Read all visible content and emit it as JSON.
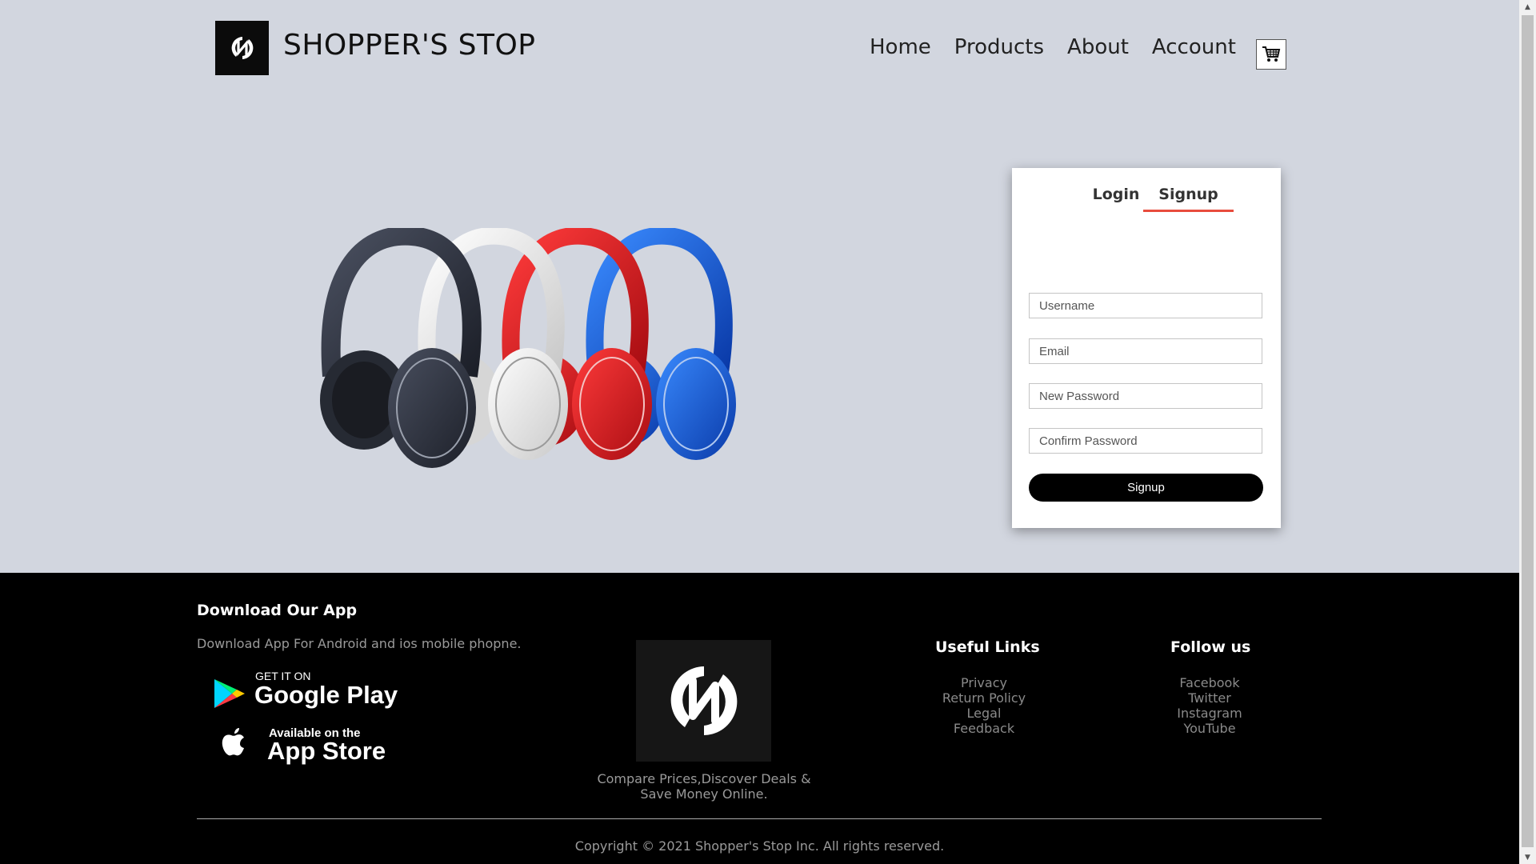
{
  "header": {
    "brand": "SHOPPER'S STOP",
    "nav": [
      "Home",
      "Products",
      "About",
      "Account"
    ],
    "icons": {
      "logo": "brand-logo-icon",
      "cart": "cart-icon"
    }
  },
  "auth": {
    "tabs": [
      "Login",
      "Signup"
    ],
    "active_tab": "Signup",
    "accent": "#e84c3d",
    "fields": {
      "username": "Username",
      "email": "Email",
      "new_password": "New Password",
      "confirm_password": "Confirm Password"
    },
    "submit_label": "Signup"
  },
  "hero": {
    "image_alt": "headphones-image"
  },
  "footer": {
    "download": {
      "title": "Download Our App",
      "text": "Download App For Android and ios mobile phopne.",
      "google_small": "GET IT ON",
      "google_big": "Google Play",
      "apple_small": "Available on the",
      "apple_big": "App Store"
    },
    "tagline_line1": "Compare Prices,Discover Deals &",
    "tagline_line2": "Save Money Online.",
    "useful_links": {
      "title": "Useful Links",
      "items": [
        "Privacy",
        "Return Policy",
        "Legal",
        "Feedback"
      ]
    },
    "follow": {
      "title": "Follow us",
      "items": [
        "Facebook",
        "Twitter",
        "Instagram",
        "YouTube"
      ]
    },
    "copyright": "Copyright © 2021 Shopper's Stop Inc. All rights reserved."
  },
  "colors": {
    "page_bg": "#d2d6df",
    "footer_bg": "#000000",
    "button_bg": "#000000"
  }
}
